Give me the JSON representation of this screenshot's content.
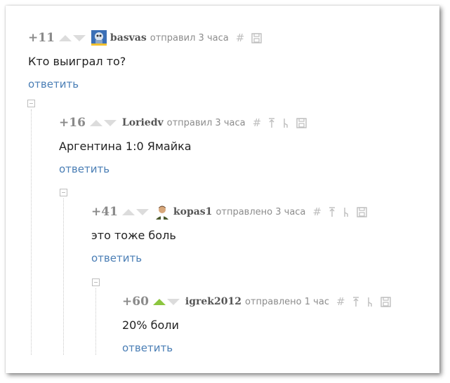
{
  "comments": [
    {
      "rating": "+11",
      "username": "basvas",
      "meta": "отправил 3 часа",
      "text": "Кто выиграл то?",
      "reply": "ответить",
      "upvoted": false,
      "avatar": "basvas-avatar",
      "icons": [
        "hash-icon",
        "save-icon"
      ]
    },
    {
      "rating": "+16",
      "username": "Loriedv",
      "meta": "отправил 3 часа",
      "text": "Аргентина 1:0 Ямайка",
      "reply": "ответить",
      "upvoted": false,
      "icons": [
        "hash-icon",
        "arrow-up-parent-icon",
        "branch-icon",
        "save-icon"
      ]
    },
    {
      "rating": "+41",
      "username": "kopas1",
      "meta": "отправлено 3 часа",
      "text": "это тоже боль",
      "reply": "ответить",
      "upvoted": false,
      "avatar": "kopas1-avatar",
      "icons": [
        "hash-icon",
        "arrow-up-parent-icon",
        "branch-icon",
        "save-icon"
      ]
    },
    {
      "rating": "+60",
      "username": "igrek2012",
      "meta": "отправлено 1 час",
      "text": "20% боли",
      "reply": "ответить",
      "upvoted": true,
      "icons": [
        "hash-icon",
        "arrow-up-parent-icon",
        "branch-icon",
        "save-icon"
      ]
    }
  ],
  "colors": {
    "reply_link": "#4a7eb5",
    "upvote_active": "#8cc63f",
    "muted": "#8c8c8c"
  }
}
